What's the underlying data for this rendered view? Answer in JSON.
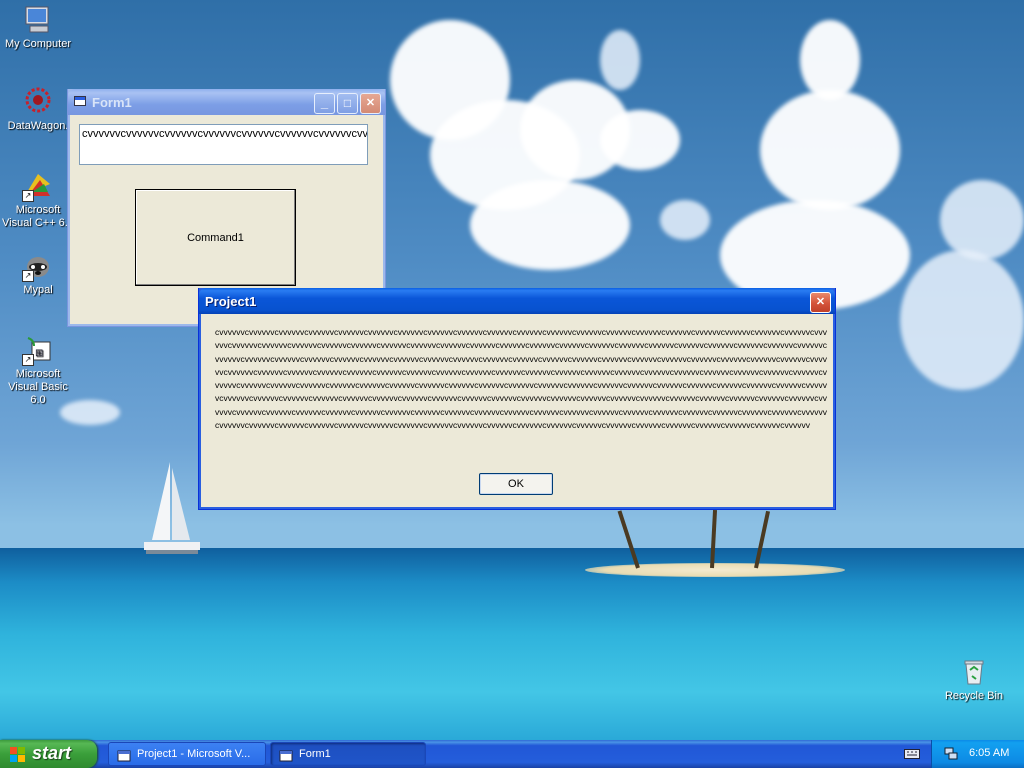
{
  "desktop": {
    "icons": [
      {
        "label": "My Computer",
        "icon": "my-computer-icon"
      },
      {
        "label": "DataWagon.",
        "icon": "datawagon-icon"
      },
      {
        "label": "Microsoft Visual C++ 6.0",
        "icon": "visual-cpp-icon"
      },
      {
        "label": "Mypal",
        "icon": "mypal-icon"
      },
      {
        "label": "Microsoft Visual Basic 6.0",
        "icon": "visual-basic-icon"
      },
      {
        "label": "Recycle Bin",
        "icon": "recycle-bin-icon"
      }
    ]
  },
  "form1": {
    "title": "Form1",
    "textbox_value": "cvvvvvvcvvvvvvcvvvvvvcvvvvvvcvvvvvvcvvvvvvcvvvvvvcvvvvvvcvvvvvvcvvvvvvcvvvvvv",
    "command_label": "Command1",
    "minimize": "_",
    "maximize": "□",
    "close": "✕"
  },
  "msgbox": {
    "title": "Project1",
    "message": "cvvvvvvcvvvvvvcvvvvvvcvvvvvvcvvvvvvcvvvvvvcvvvvvvcvvvvvvcvvvvvvcvvvvvvcvvvvvvcvvvvvvcvvvvvvcvvvvvvcvvvvvvcvvvvvvcvvvvvvcvvvvvvcvvvvvvcvvvvvvcvvvvvvcvvvvvvcvvvvvvcvvvvvvcvvvvvvcvvvvvvcvvvvvvcvvvvvvcvvvvvvcvvvvvvcvvvvvvcvvvvvvcvvvvvvcvvvvvvcvvvvvvcvvvvvvcvvvvvvcvvvvvvcvvvvvvcvvvvvvcvvvvvvcvvvvvvcvvvvvvcvvvvvvcvvvvvvcvvvvvvcvvvvvvcvvvvvvcvvvvvvcvvvvvvcvvvvvvcvvvvvvcvvvvvvcvvvvvvcvvvvvvcvvvvvvcvvvvvvcvvvvvvcvvvvvvcvvvvvvcvvvvvvcvvvvvvcvvvvvvcvvvvvvcvvvvvvcvvvvvvcvvvvvvcvvvvvvcvvvvvvcvvvvvvcvvvvvvcvvvvvvcvvvvvvcvvvvvvcvvvvvvcvvvvvvcvvvvvvcvvvvvvcvvvvvvcvvvvvvcvvvvvvcvvvvvvcvvvvvvcvvvvvvcvvvvvvcvvvvvvcvvvvvvcvvvvvvcvvvvvvcvvvvvvcvvvvvvcvvvvvvcvvvvvvcvvvvvvcvvvvvvcvvvvvvcvvvvvvcvvvvvvcvvvvvvcvvvvvvcvvvvvvcvvvvvvcvvvvvvcvvvvvvcvvvvvvcvvvvvvcvvvvvvcvvvvvvcvvvvvvcvvvvvvcvvvvvvcvvvvvvcvvvvvvcvvvvvvcvvvvvvcvvvvvvcvvvvvvcvvvvvvcvvvvvvcvvvvvvcvvvvvvcvvvvvvcvvvvvvcvvvvvvcvvvvvvcvvvvvvcvvvvvvcvvvvvvcvvvvvvcvvvvvvcvvvvvvcvvvvvvcvvvvvvcvvvvvvcvvvvvvcvvvvvvcvvvvvvcvvvvvvcvvvvvvcvvvvvvcvvvvvvcvvvvvvcvvvvvvcvvvvvvcvvvvvvcvvvvvvcvvvvvvcvvvvvvcvvvvvvcvvvvvvcvvvvvvcvvvvvvcvvvvvvcvvvvvvcvvvvvvcvvvvvvcvvvvvvcvvvvvvcvvvvvvcvvvvvvcvvvvvvcvvvvvvcvvvvvvcvvvvvv",
    "ok_label": "OK",
    "close": "✕"
  },
  "taskbar": {
    "start_label": "start",
    "tasks": [
      {
        "label": "Project1 - Microsoft V...",
        "active": false
      },
      {
        "label": "Form1",
        "active": true
      }
    ],
    "clock": "6:05 AM"
  },
  "colors": {
    "titlebar_active": "#0852cf",
    "window_face": "#ece9d8",
    "taskbar": "#245edb",
    "start_green": "#3a9f3a",
    "tray": "#0d8ae4"
  }
}
